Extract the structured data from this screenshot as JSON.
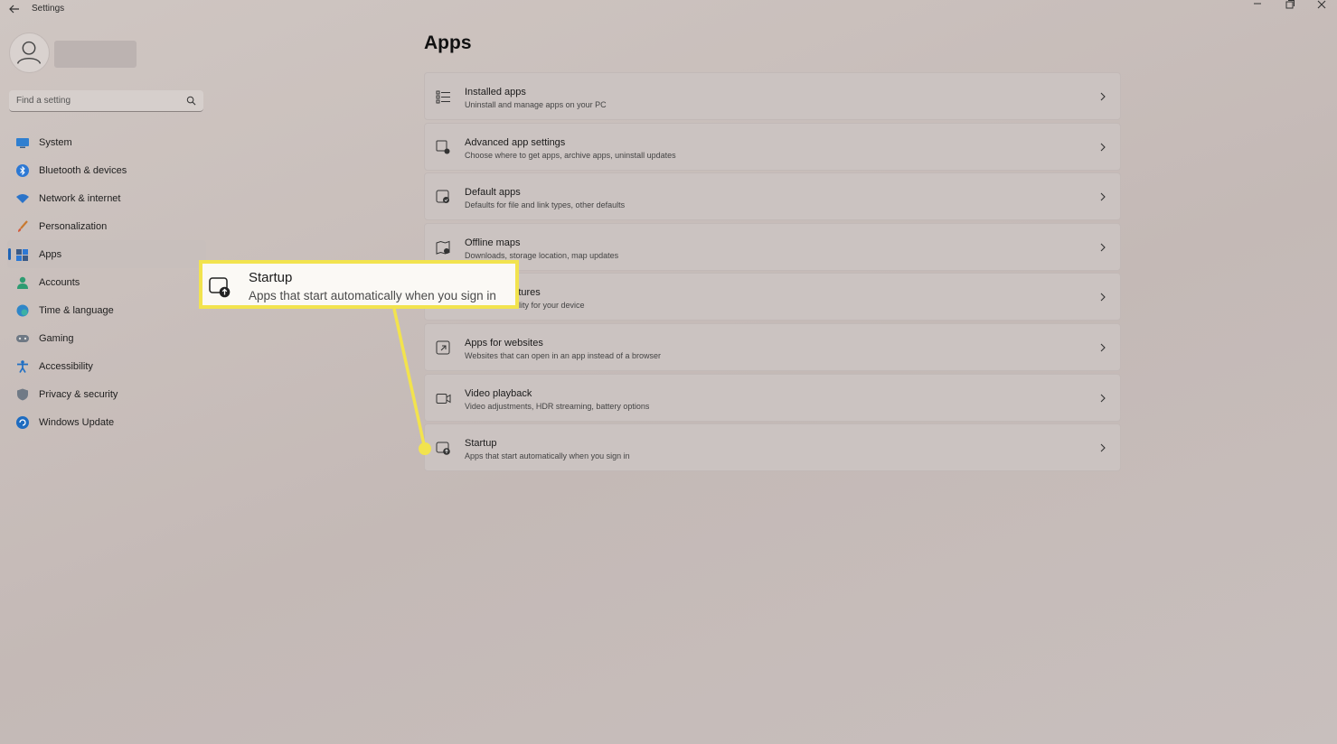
{
  "window": {
    "title": "Settings"
  },
  "search": {
    "placeholder": "Find a setting"
  },
  "sidebar": {
    "items": [
      {
        "label": "System",
        "icon": "monitor-icon",
        "active": false
      },
      {
        "label": "Bluetooth & devices",
        "icon": "bluetooth-icon",
        "active": false
      },
      {
        "label": "Network & internet",
        "icon": "wifi-icon",
        "active": false
      },
      {
        "label": "Personalization",
        "icon": "paintbrush-icon",
        "active": false
      },
      {
        "label": "Apps",
        "icon": "apps-icon",
        "active": true
      },
      {
        "label": "Accounts",
        "icon": "person-icon",
        "active": false
      },
      {
        "label": "Time & language",
        "icon": "globe-clock-icon",
        "active": false
      },
      {
        "label": "Gaming",
        "icon": "gamepad-icon",
        "active": false
      },
      {
        "label": "Accessibility",
        "icon": "accessibility-icon",
        "active": false
      },
      {
        "label": "Privacy & security",
        "icon": "shield-icon",
        "active": false
      },
      {
        "label": "Windows Update",
        "icon": "update-icon",
        "active": false
      }
    ]
  },
  "main": {
    "title": "Apps",
    "items": [
      {
        "title": "Installed apps",
        "subtitle": "Uninstall and manage apps on your PC",
        "icon": "list-icon"
      },
      {
        "title": "Advanced app settings",
        "subtitle": "Choose where to get apps, archive apps, uninstall updates",
        "icon": "app-settings-icon"
      },
      {
        "title": "Default apps",
        "subtitle": "Defaults for file and link types, other defaults",
        "icon": "default-apps-icon"
      },
      {
        "title": "Offline maps",
        "subtitle": "Downloads, storage location, map updates",
        "icon": "map-icon"
      },
      {
        "title": "Optional features",
        "subtitle": "Extra functionality for your device",
        "icon": "optional-features-icon"
      },
      {
        "title": "Apps for websites",
        "subtitle": "Websites that can open in an app instead of a browser",
        "icon": "open-in-app-icon"
      },
      {
        "title": "Video playback",
        "subtitle": "Video adjustments, HDR streaming, battery options",
        "icon": "video-icon"
      },
      {
        "title": "Startup",
        "subtitle": "Apps that start automatically when you sign in",
        "icon": "startup-icon"
      }
    ]
  },
  "callout": {
    "title": "Startup",
    "subtitle": "Apps that start automatically when you sign in",
    "accent_color": "#f2e34e"
  },
  "colors": {
    "background": "#c8bfbc",
    "accent": "#1e63b5",
    "highlight": "#f2e34e"
  }
}
